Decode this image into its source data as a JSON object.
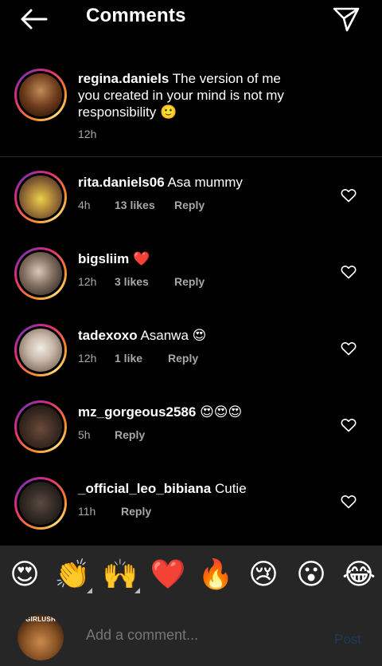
{
  "header": {
    "title": "Comments"
  },
  "caption": {
    "username": "regina.daniels",
    "lines": [
      "The version of me",
      "you created in your mind is not my",
      "responsibility 🙂"
    ],
    "time": "12h"
  },
  "comments": [
    {
      "username": "rita.daniels06",
      "text": "Asa mummy",
      "time": "4h",
      "likes": "13 likes",
      "reply": "Reply"
    },
    {
      "username": "bigsliim",
      "text": "❤️",
      "time": "12h",
      "likes": "3 likes",
      "reply": "Reply"
    },
    {
      "username": "tadexoxo",
      "text": "Asanwa 😍",
      "time": "12h",
      "likes": "1 like",
      "reply": "Reply"
    },
    {
      "username": "mz_gorgeous2586",
      "text": "😍😍😍",
      "time": "5h",
      "likes": "",
      "reply": "Reply"
    },
    {
      "username": "_official_leo_bibiana",
      "text": "Cutie",
      "time": "11h",
      "likes": "",
      "reply": "Reply"
    }
  ],
  "emoji_bar": [
    "😍",
    "👏",
    "🙌",
    "❤️",
    "🔥",
    "😢",
    "😮",
    "😂"
  ],
  "composer": {
    "placeholder": "Add a comment...",
    "post": "Post",
    "avatar_label": "GIRLUSH"
  },
  "colors": {
    "background": "#000000",
    "panel": "#262626",
    "meta": "#a8a8a8",
    "post_disabled": "#1f3a5a"
  }
}
